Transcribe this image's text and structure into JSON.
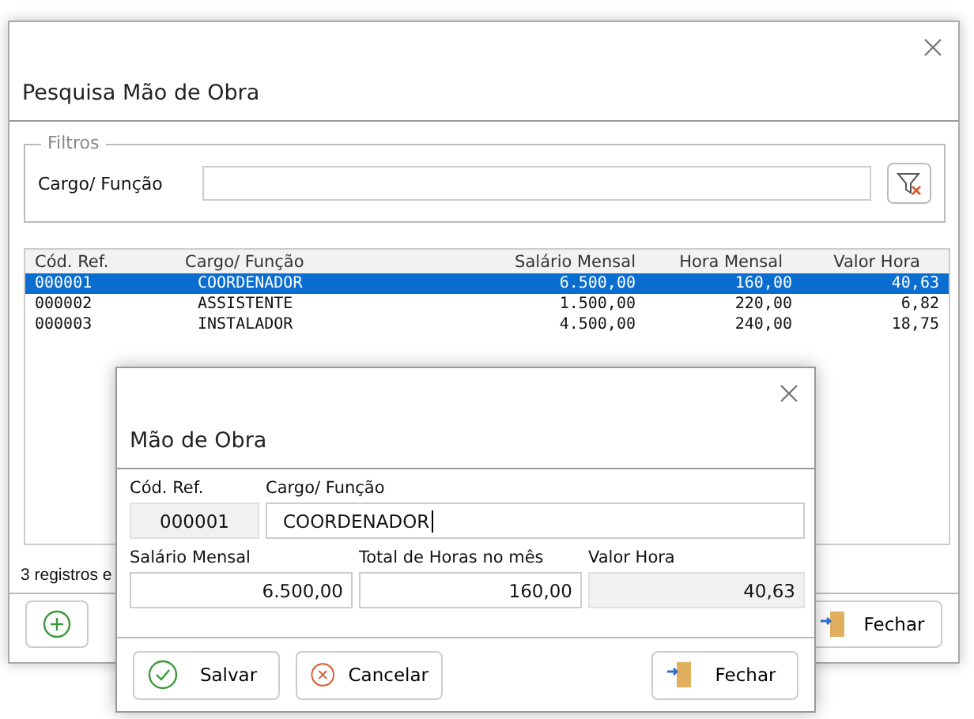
{
  "window": {
    "title": "Pesquisa Mão de Obra"
  },
  "filters": {
    "legend": "Filtros",
    "label": "Cargo/ Função"
  },
  "table": {
    "columns": [
      {
        "label": "Cód. Ref."
      },
      {
        "label": "Cargo/ Função"
      },
      {
        "label": "Salário Mensal"
      },
      {
        "label": "Hora Mensal"
      },
      {
        "label": "Valor Hora"
      }
    ],
    "rows": [
      {
        "selected": true,
        "cells": [
          "000001",
          "COORDENADOR",
          "6.500,00",
          "160,00",
          "40,63"
        ]
      },
      {
        "selected": false,
        "cells": [
          "000002",
          "ASSISTENTE",
          "1.500,00",
          "220,00",
          "6,82"
        ]
      },
      {
        "selected": false,
        "cells": [
          "000003",
          "INSTALADOR",
          "4.500,00",
          "240,00",
          "18,75"
        ]
      }
    ]
  },
  "status": "3 registros e",
  "footer": {
    "close_label": "Fechar"
  },
  "dialog": {
    "title": "Mão de Obra",
    "fields": [
      {
        "label": "Cód. Ref.",
        "value": "000001",
        "readonly": true,
        "focused": false
      },
      {
        "label": "Cargo/ Função",
        "value": "COORDENADOR",
        "readonly": false,
        "focused": true
      },
      {
        "label": "Salário Mensal",
        "value": "6.500,00",
        "readonly": false,
        "focused": false
      },
      {
        "label": "Total de Horas no mês",
        "value": "160,00",
        "readonly": false,
        "focused": false
      },
      {
        "label": "Valor Hora",
        "value": "40,63",
        "readonly": true,
        "focused": false
      }
    ],
    "buttons": [
      {
        "kind": "save",
        "label": "Salvar"
      },
      {
        "kind": "cancel",
        "label": "Cancelar"
      },
      {
        "kind": "close",
        "label": "Fechar"
      }
    ]
  }
}
